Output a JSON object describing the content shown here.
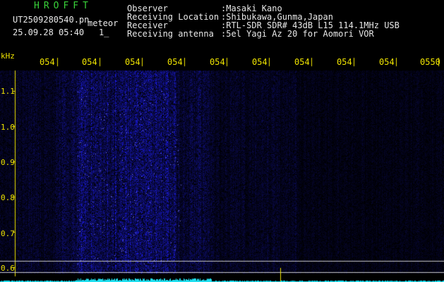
{
  "header": {
    "app": "HROFFT",
    "file_name": "UT2509280540.pn",
    "mode": "meteor",
    "date_time": "25.09.28 05:40",
    "counter": "1_",
    "fields": [
      {
        "label": "Observer",
        "value": ":Masaki Kano"
      },
      {
        "label": "Receiving Location",
        "value": ":Shibukawa,Gunma,Japan"
      },
      {
        "label": "Receiver",
        "value": ":RTL-SDR SDR# 43dB L15 114.1MHz USB"
      },
      {
        "label": "Receiving antenna",
        "value": ":5el Yagi Az 20 for Aomori VOR"
      }
    ]
  },
  "axis": {
    "unit": "kHz",
    "y_labels": [
      "1.1",
      "1.0",
      "0.9",
      "0.8",
      "0.7",
      "0.6"
    ],
    "x_labels": [
      "054",
      "054",
      "054",
      "054",
      "054",
      "054",
      "054",
      "054",
      "054",
      "0550"
    ]
  },
  "colors": {
    "background": "#000000",
    "spectrum_blue": "#1a1aa0",
    "axis_yellow": "#f0e400",
    "title_green": "#39d23a",
    "trace_cyan": "#1fe0f0"
  }
}
